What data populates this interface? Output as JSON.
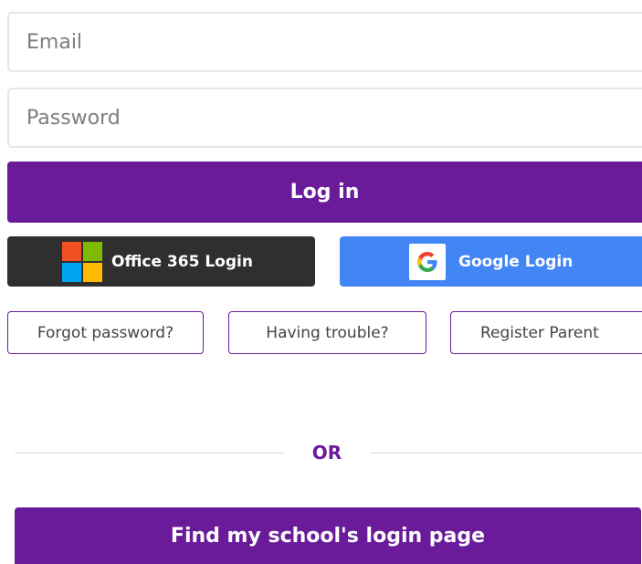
{
  "login_form": {
    "email_placeholder": "Email",
    "password_placeholder": "Password",
    "login_label": "Log in"
  },
  "sso": {
    "office_label": "Office 365 Login",
    "office_icon": "microsoft-logo-icon",
    "google_label": "Google Login",
    "google_icon": "google-logo-icon"
  },
  "help_links": {
    "forgot_label": "Forgot password?",
    "trouble_label": "Having trouble?",
    "register_label": "Register Parent"
  },
  "separator": {
    "text": "OR"
  },
  "school": {
    "find_label": "Find my school's login page"
  },
  "colors": {
    "primary": "#6a1b9a",
    "office_bg": "#2f2f2f",
    "google_bg": "#4285f4",
    "ms_red": "#f25022",
    "ms_green": "#7fba00",
    "ms_blue": "#00a4ef",
    "ms_yellow": "#ffb900"
  }
}
